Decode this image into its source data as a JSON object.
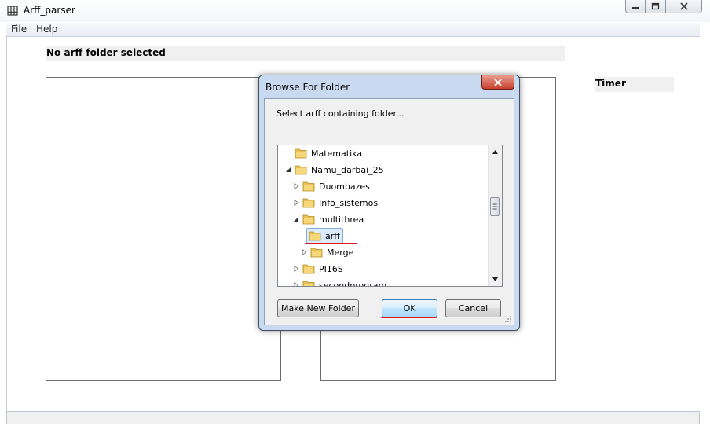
{
  "window": {
    "title": "Arff_parser",
    "icon": "grid-app-icon"
  },
  "menu": {
    "file": "File",
    "help": "Help"
  },
  "main": {
    "status": "No arff folder selected",
    "timer_label": "Timer"
  },
  "dialog": {
    "title": "Browse For Folder",
    "prompt": "Select arff containing folder...",
    "tree": [
      {
        "label": "Matematika",
        "level": 1,
        "expander": "none"
      },
      {
        "label": "Namu_darbai_25",
        "level": 1,
        "expander": "expanded"
      },
      {
        "label": "Duombazes",
        "level": 2,
        "expander": "collapsed"
      },
      {
        "label": "Info_sistemos",
        "level": 2,
        "expander": "collapsed"
      },
      {
        "label": "multithrea",
        "level": 2,
        "expander": "expanded"
      },
      {
        "label": "arff",
        "level": 3,
        "expander": "none",
        "selected": true
      },
      {
        "label": "Merge",
        "level": 3,
        "expander": "collapsed"
      },
      {
        "label": "PI16S",
        "level": 2,
        "expander": "collapsed"
      },
      {
        "label": "secondprogram",
        "level": 2,
        "expander": "collapsed"
      }
    ],
    "buttons": {
      "make_new_folder": "Make New Folder",
      "ok": "OK",
      "cancel": "Cancel"
    }
  },
  "colors": {
    "annotation_red": "#e0141e",
    "dialog_frame": "#c9daf0",
    "selection": "#dcebfc"
  }
}
